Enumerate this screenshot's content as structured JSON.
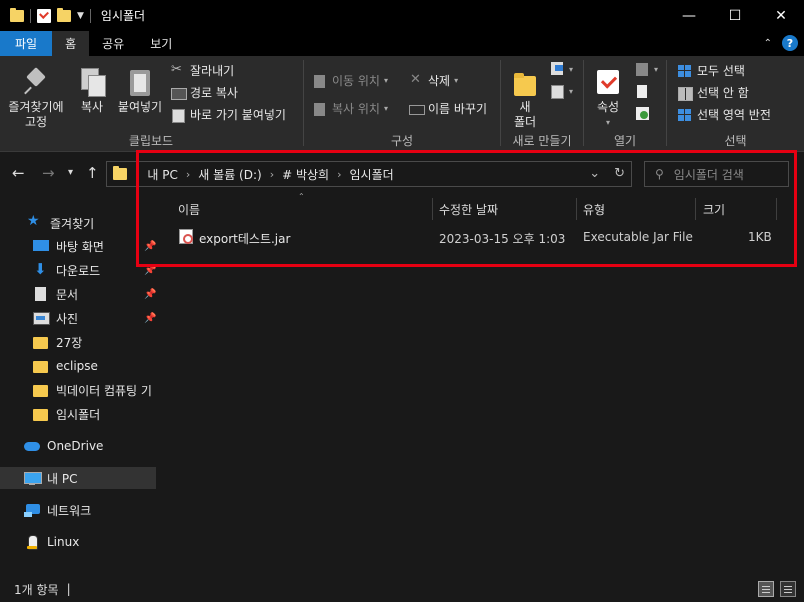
{
  "window": {
    "title": "임시폴더",
    "minimize": "—",
    "maximize": "☐",
    "close": "✕"
  },
  "ribbon_tabs": {
    "file": "파일",
    "home": "홈",
    "share": "공유",
    "view": "보기",
    "help": "?"
  },
  "ribbon": {
    "clipboard": {
      "label": "클립보드",
      "pin": "즐겨찾기에\n고정",
      "copy": "복사",
      "paste": "붙여넣기",
      "cut": "잘라내기",
      "copy_path": "경로 복사",
      "paste_shortcut": "바로 가기 붙여넣기"
    },
    "organize": {
      "label": "구성",
      "move_to": "이동 위치",
      "copy_to": "복사 위치",
      "delete": "삭제",
      "rename": "이름 바꾸기"
    },
    "new": {
      "label": "새로 만들기",
      "new_folder": "새\n폴더"
    },
    "open": {
      "label": "열기",
      "properties": "속성"
    },
    "select": {
      "label": "선택",
      "select_all": "모두 선택",
      "select_none": "선택 안 함",
      "invert": "선택 영역 반전"
    }
  },
  "address": {
    "crumbs": [
      "내 PC",
      "새 볼륨 (D:)",
      "# 박상희",
      "임시폴더"
    ],
    "search_placeholder": "임시폴더 검색"
  },
  "sidebar": {
    "items": [
      {
        "label": "즐겨찾기",
        "icon": "star-icon"
      },
      {
        "label": "바탕 화면",
        "icon": "desktop-icon",
        "pinned": true
      },
      {
        "label": "다운로드",
        "icon": "download-icon",
        "pinned": true
      },
      {
        "label": "문서",
        "icon": "document-icon",
        "pinned": true
      },
      {
        "label": "사진",
        "icon": "pictures-icon",
        "pinned": true
      },
      {
        "label": "27장",
        "icon": "folder-icon"
      },
      {
        "label": "eclipse",
        "icon": "folder-icon"
      },
      {
        "label": "빅데이터 컴퓨팅 기",
        "icon": "folder-icon"
      },
      {
        "label": "임시폴더",
        "icon": "folder-icon"
      },
      {
        "label": "OneDrive",
        "icon": "onedrive-icon"
      },
      {
        "label": "내 PC",
        "icon": "pc-icon",
        "selected": true
      },
      {
        "label": "네트워크",
        "icon": "network-icon"
      },
      {
        "label": "Linux",
        "icon": "linux-icon"
      }
    ]
  },
  "columns": {
    "name": "이름",
    "modified": "수정한 날짜",
    "type": "유형",
    "size": "크기"
  },
  "files": [
    {
      "name": "export테스트.jar",
      "modified": "2023-03-15 오후 1:03",
      "type": "Executable Jar File",
      "size": "1KB"
    }
  ],
  "status": {
    "count": "1개 항목",
    "cursor": "|"
  },
  "colors": {
    "highlight": "#e60012",
    "file_tab": "#1979ca",
    "background": "#191919"
  }
}
